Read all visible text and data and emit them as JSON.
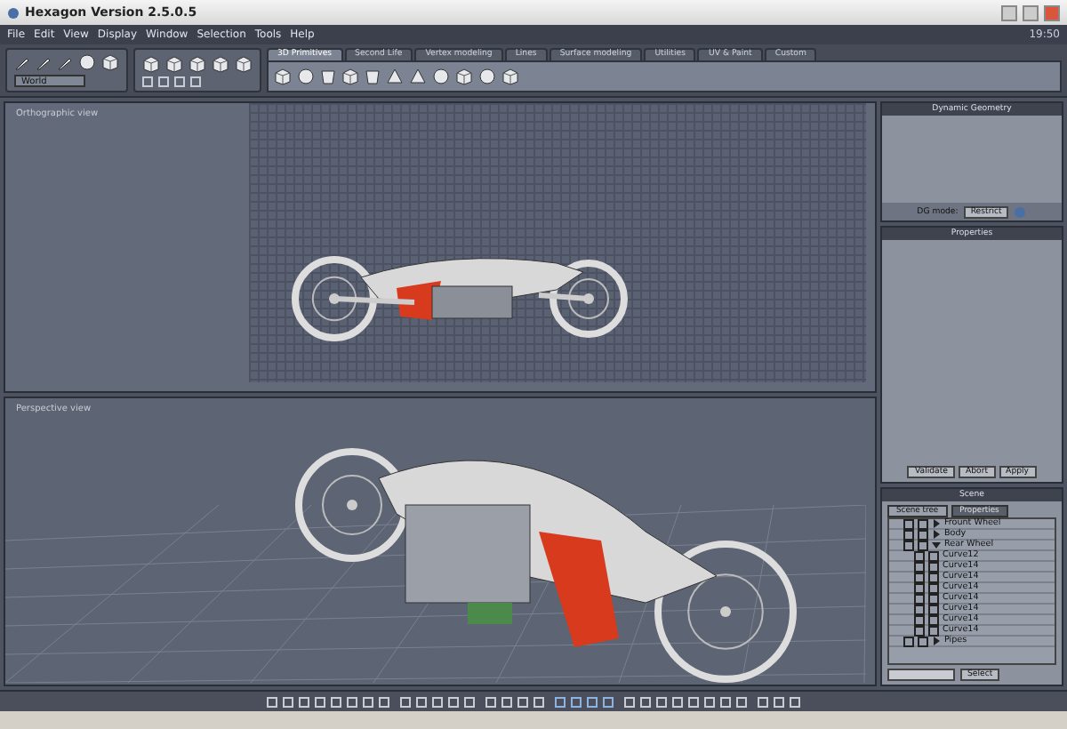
{
  "window": {
    "title": "Hexagon Version 2.5.0.5"
  },
  "menu": [
    "File",
    "Edit",
    "View",
    "Display",
    "Window",
    "Selection",
    "Tools",
    "Help"
  ],
  "clock": "19:50",
  "coordinate_space": {
    "value": "World"
  },
  "tabs": [
    {
      "label": "3D Primitives",
      "selected": true
    },
    {
      "label": "Second Life",
      "selected": false
    },
    {
      "label": "Vertex modeling",
      "selected": false
    },
    {
      "label": "Lines",
      "selected": false
    },
    {
      "label": "Surface modeling",
      "selected": false
    },
    {
      "label": "Utilities",
      "selected": false
    },
    {
      "label": "UV & Paint",
      "selected": false
    },
    {
      "label": "Custom",
      "selected": false
    }
  ],
  "viewports": [
    {
      "label": "Orthographic view",
      "kind": "side"
    },
    {
      "label": "Perspective view",
      "kind": "perspective"
    }
  ],
  "dynamic_geometry": {
    "title": "Dynamic Geometry",
    "mode_label": "DG mode:",
    "mode_value": "Restrict"
  },
  "properties": {
    "title": "Properties",
    "buttons": [
      "Validate",
      "Abort",
      "Apply"
    ]
  },
  "scene": {
    "title": "Scene",
    "tabs": [
      {
        "label": "Scene tree",
        "selected": true
      },
      {
        "label": "Properties",
        "selected": false
      }
    ],
    "tree": [
      {
        "label": "Frount Wheel",
        "expanded": false
      },
      {
        "label": "Body",
        "expanded": false
      },
      {
        "label": "Rear Wheel",
        "expanded": true,
        "children": [
          {
            "label": "Curve12"
          },
          {
            "label": "Curve14"
          },
          {
            "label": "Curve14"
          },
          {
            "label": "Curve14"
          },
          {
            "label": "Curve14"
          },
          {
            "label": "Curve14"
          },
          {
            "label": "Curve14"
          },
          {
            "label": "Curve14"
          }
        ]
      },
      {
        "label": "Pipes",
        "expanded": false
      }
    ],
    "select_button": "Select"
  }
}
